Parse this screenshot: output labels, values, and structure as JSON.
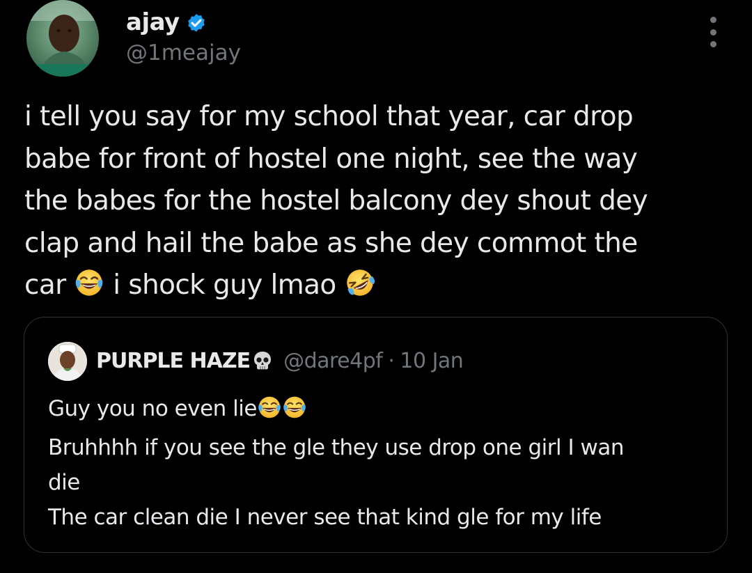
{
  "author": {
    "name": "ajay",
    "handle": "@1meajay",
    "verified": true,
    "verified_color": "#1d9bf0"
  },
  "tweet": {
    "lines": [
      "i tell you say for my school that year, car drop",
      "babe for front of hostel one night, see the way",
      "the babes for the hostel balcony dey shout dey",
      "clap and hail the babe as she dey commot the"
    ],
    "last_line_a": "car",
    "last_line_emoji_1": "face-with-tears-of-joy",
    "last_line_b": "i shock guy lmao",
    "last_line_emoji_2": "rolling-on-the-floor-laughing"
  },
  "quote": {
    "name": "PURPLE HAZE",
    "name_emoji": "skull",
    "handle": "@dare4pf",
    "separator": "·",
    "date": "10 Jan",
    "line1": "Guy you no even lie",
    "line1_emojis": [
      "face-with-tears-of-joy",
      "face-with-tears-of-joy"
    ],
    "line2": "Bruhhhh if you see the gle they use drop one girl I wan",
    "line3": "die",
    "line4": "The car clean die I never see that kind gle for my life"
  },
  "colors": {
    "background": "#000000",
    "text_primary": "#e7e9ea",
    "text_secondary": "#71767b",
    "border": "#2f3336",
    "accent": "#1d9bf0"
  },
  "icons": {
    "more": "more-dots-icon",
    "verified": "verified-badge-icon",
    "skull": "skull-emoji-icon"
  }
}
